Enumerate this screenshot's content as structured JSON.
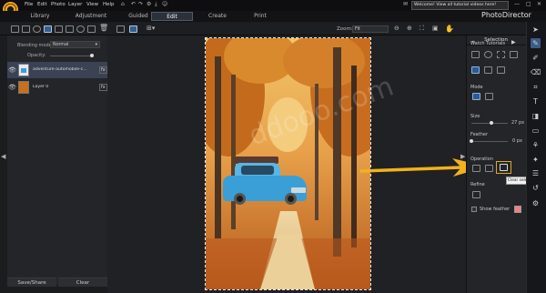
{
  "menu": {
    "items": [
      "File",
      "Edit",
      "Photo",
      "Layer",
      "View",
      "Help"
    ],
    "notification": "Welcome! View all tutorial videos here!",
    "window_controls": [
      "—",
      "□",
      "✕"
    ]
  },
  "modes": {
    "tabs": [
      "Library",
      "Adjustment",
      "Guided",
      "Edit",
      "Create",
      "Print"
    ],
    "active": "Edit"
  },
  "app_title": "PhotoDirector",
  "toolbar": {
    "zoom_label": "Zoom:",
    "zoom_value": "Fit"
  },
  "layers_panel": {
    "blending_label": "Blending mode:",
    "blending_value": "Normal",
    "opacity_label": "Opacity:",
    "opacity_value": "100",
    "layers": [
      {
        "name": "adventure-automobile-c...",
        "selected": true
      },
      {
        "name": "Layer 0",
        "selected": false
      }
    ],
    "fx_label": "fx",
    "save_share": "Save/Share",
    "clear": "Clear"
  },
  "selection_panel": {
    "title": "Selection",
    "watch_tutorials": "Watch Tutorials",
    "mode_label": "Mode",
    "size_label": "Size",
    "size_value": "27 px",
    "size_level": 0.55,
    "feather_label": "Feather",
    "feather_value": "0 px",
    "feather_level": 0.0,
    "operation_label": "Operation",
    "refine_label": "Refine",
    "show_feather_label": "Show feather",
    "tooltip": "Clear selection",
    "feather_color": "#f08080"
  },
  "watermark": "ddooo.com",
  "colors": {
    "accent": "#e3a81c",
    "selected_blue": "#2e5a92",
    "arrow": "#f2b21e"
  }
}
